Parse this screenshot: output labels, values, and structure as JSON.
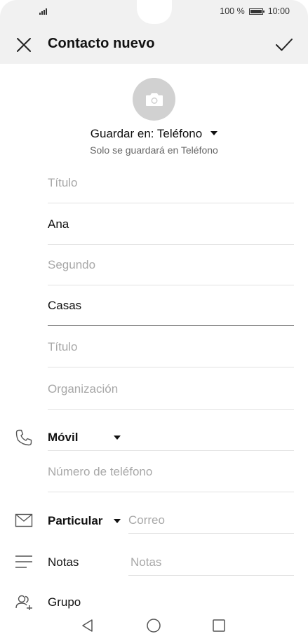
{
  "status_bar": {
    "battery_text": "100 %",
    "time": "10:00"
  },
  "header": {
    "title": "Contacto nuevo",
    "close_icon": "close-icon",
    "confirm_icon": "check-icon"
  },
  "photo": {
    "icon": "camera-icon"
  },
  "storage": {
    "label": "Guardar en: Teléfono",
    "note": "Solo se guardará en Teléfono"
  },
  "fields": {
    "prefix_placeholder": "Título",
    "first_name": "Ana",
    "middle_placeholder": "Segundo",
    "last_name": "Casas",
    "suffix_placeholder": "Título",
    "organization_placeholder": "Organización"
  },
  "phone": {
    "type": "Móvil",
    "number_placeholder": "Número de teléfono"
  },
  "email": {
    "type": "Particular",
    "placeholder": "Correo"
  },
  "notes": {
    "label": "Notas",
    "placeholder": "Notas"
  },
  "group": {
    "label": "Grupo"
  },
  "navigation": {
    "back_icon": "back-icon",
    "home_icon": "home-icon",
    "recents_icon": "recents-icon"
  }
}
